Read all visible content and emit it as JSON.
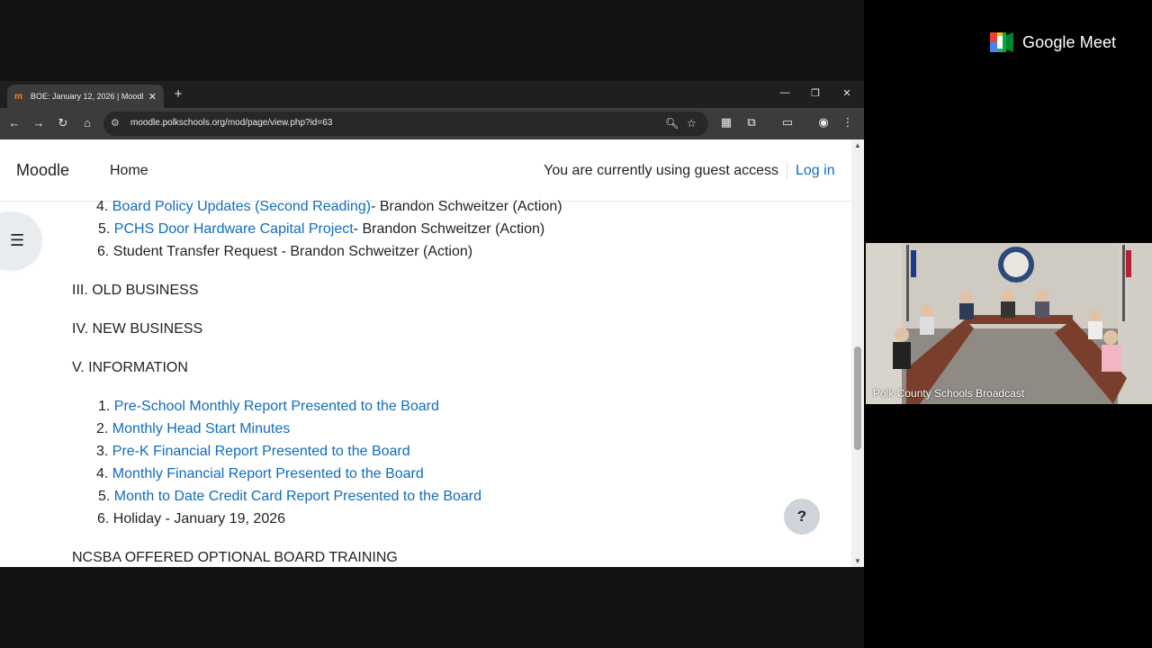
{
  "meet": {
    "brand": "Google Meet",
    "participant_name": "Polk County Schools Broadcast"
  },
  "browser": {
    "tab_title": "BOE: January 12, 2026 | Moodle",
    "tab_favicon": "moodle-icon",
    "url": "moodle.polkschools.org/mod/page/view.php?id=63"
  },
  "page": {
    "brand": "Moodle",
    "nav_home": "Home",
    "guest_text": "You are currently using guest access",
    "login": "Log in",
    "help": "?",
    "items": [
      {
        "num": "4.",
        "link": "Board Policy Updates (Second Reading)",
        "rest": "- Brandon Schweitzer (Action)"
      },
      {
        "num": "5.",
        "link": "PCHS Door Hardware Capital Project",
        "rest": "- Brandon Schweitzer (Action)"
      },
      {
        "num": "6.",
        "text": "Student Transfer Request - Brandon Schweitzer (Action)"
      }
    ],
    "sections": {
      "old_business": "III.  OLD BUSINESS",
      "new_business": "IV.  NEW BUSINESS",
      "information": "V.  INFORMATION",
      "training": "NCSBA OFFERED OPTIONAL BOARD TRAINING"
    },
    "info_items": [
      {
        "num": "1.",
        "link": "Pre-School Monthly Report Presented to the Board"
      },
      {
        "num": "2.",
        "link": "Monthly Head Start Minutes"
      },
      {
        "num": "3.",
        "link": "Pre-K Financial Report Presented to the Board"
      },
      {
        "num": "4.",
        "link": "Monthly Financial Report Presented to the Board"
      },
      {
        "num": "5.",
        "link": "Month to Date Credit Card Report Presented to the Board"
      },
      {
        "num": "6.",
        "text": "Holiday - January 19, 2026"
      }
    ]
  },
  "colors": {
    "link": "#0f6cbf",
    "text": "#1d2125",
    "meet_bg": "#000000"
  }
}
